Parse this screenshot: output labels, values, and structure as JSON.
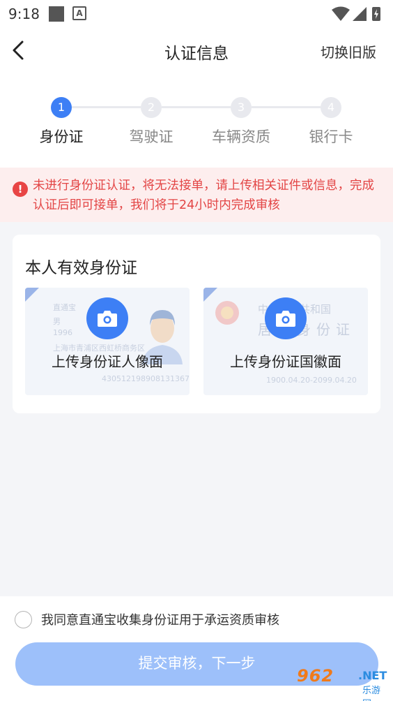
{
  "status": {
    "time": "9:18",
    "a_icon": "A"
  },
  "nav": {
    "title": "认证信息",
    "switch_label": "切换旧版"
  },
  "steps": [
    {
      "num": "1",
      "label": "身份证",
      "active": true
    },
    {
      "num": "2",
      "label": "驾驶证",
      "active": false
    },
    {
      "num": "3",
      "label": "车辆资质",
      "active": false
    },
    {
      "num": "4",
      "label": "银行卡",
      "active": false
    }
  ],
  "alert": {
    "icon": "!",
    "text": "未进行身份证认证，将无法接单，请上传相关证件或信息，完成认证后即可接单，我们将于24小时内完成审核"
  },
  "card": {
    "title": "本人有效身份证",
    "front": {
      "upload_label": "上传身份证人像面",
      "sample_name": "直通宝",
      "sample_sex": "男",
      "sample_year": "1996",
      "sample_addr": "上海市青浦区西虹桥商务区",
      "sample_id": "430512198908131367"
    },
    "back": {
      "upload_label": "上传身份证国徽面",
      "sample_header": "中华人民共和国",
      "sample_title": "居民身份证",
      "sample_valid": "1900.04.20-2099.04.20"
    }
  },
  "footer": {
    "agree_text": "我同意直通宝收集身份证用于承运资质审核",
    "submit_label": "提交审核，下一步"
  },
  "watermark": {
    "number": "962",
    "suffix": ".NET",
    "site": "乐游网"
  },
  "colors": {
    "primary": "#3d7ff5",
    "button_disabled": "#9dc0fa",
    "alert_bg": "#fdeeee",
    "alert_text": "#e34545"
  }
}
